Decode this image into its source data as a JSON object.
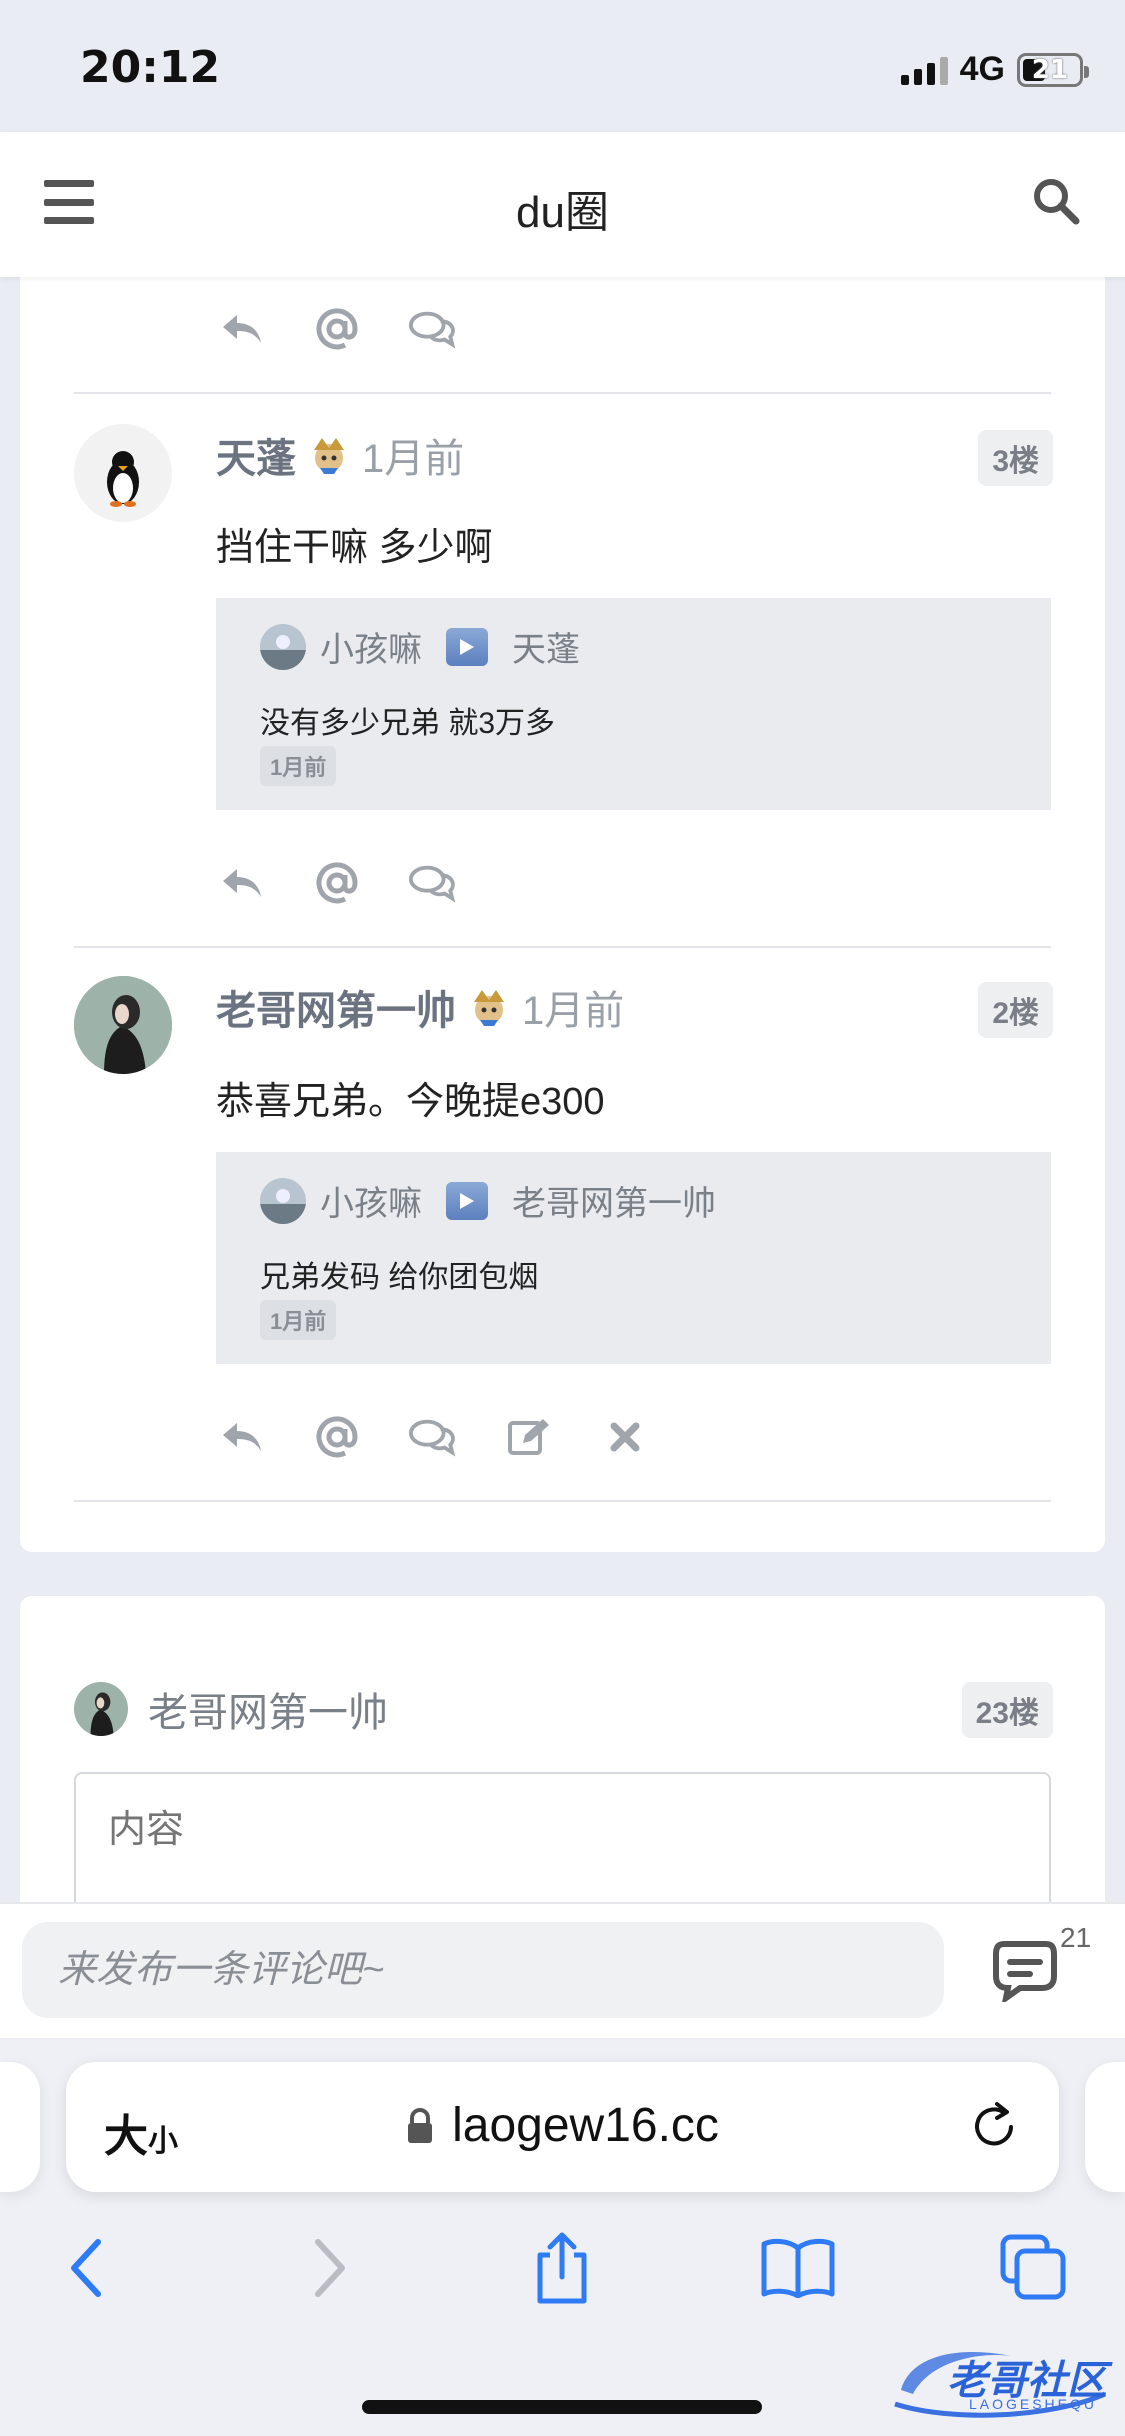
{
  "status": {
    "time": "20:12",
    "network": "4G",
    "battery": "21"
  },
  "app": {
    "title": "du圈"
  },
  "comments": [
    {
      "name": "天蓬",
      "time": "1月前",
      "floor": "3楼",
      "body": "挡住干嘛  多少啊",
      "reply": {
        "from": "小孩嘛",
        "to": "天蓬",
        "text": "没有多少兄弟 就3万多",
        "time": "1月前"
      }
    },
    {
      "name": "老哥网第一帅",
      "time": "1月前",
      "floor": "2楼",
      "body": "恭喜兄弟。今晚提e300",
      "reply": {
        "from": "小孩嘛",
        "to": "老哥网第一帅",
        "text": "兄弟发码 给你团包烟",
        "time": "1月前"
      }
    }
  ],
  "composer": {
    "name": "老哥网第一帅",
    "floor": "23楼",
    "placeholder": "内容"
  },
  "comment_bar": {
    "placeholder": "来发布一条评论吧~",
    "count": "21"
  },
  "browser": {
    "aa_big": "大",
    "aa_small": "小",
    "url": "laogew16.cc"
  },
  "watermark": {
    "text": "老哥社区",
    "sub": "LAOGESHEQU"
  },
  "colors": {
    "accent": "#2a63d8",
    "icon_gray": "#a0a4ab",
    "ios_blue": "#2f7bf6"
  },
  "icons": [
    "menu-icon",
    "search-icon",
    "reply-icon",
    "at-icon",
    "comment-icon",
    "edit-icon",
    "delete-icon",
    "play-icon",
    "lock-icon",
    "reload-icon",
    "back-icon",
    "forward-icon",
    "share-icon",
    "bookmarks-icon",
    "tabs-icon"
  ]
}
